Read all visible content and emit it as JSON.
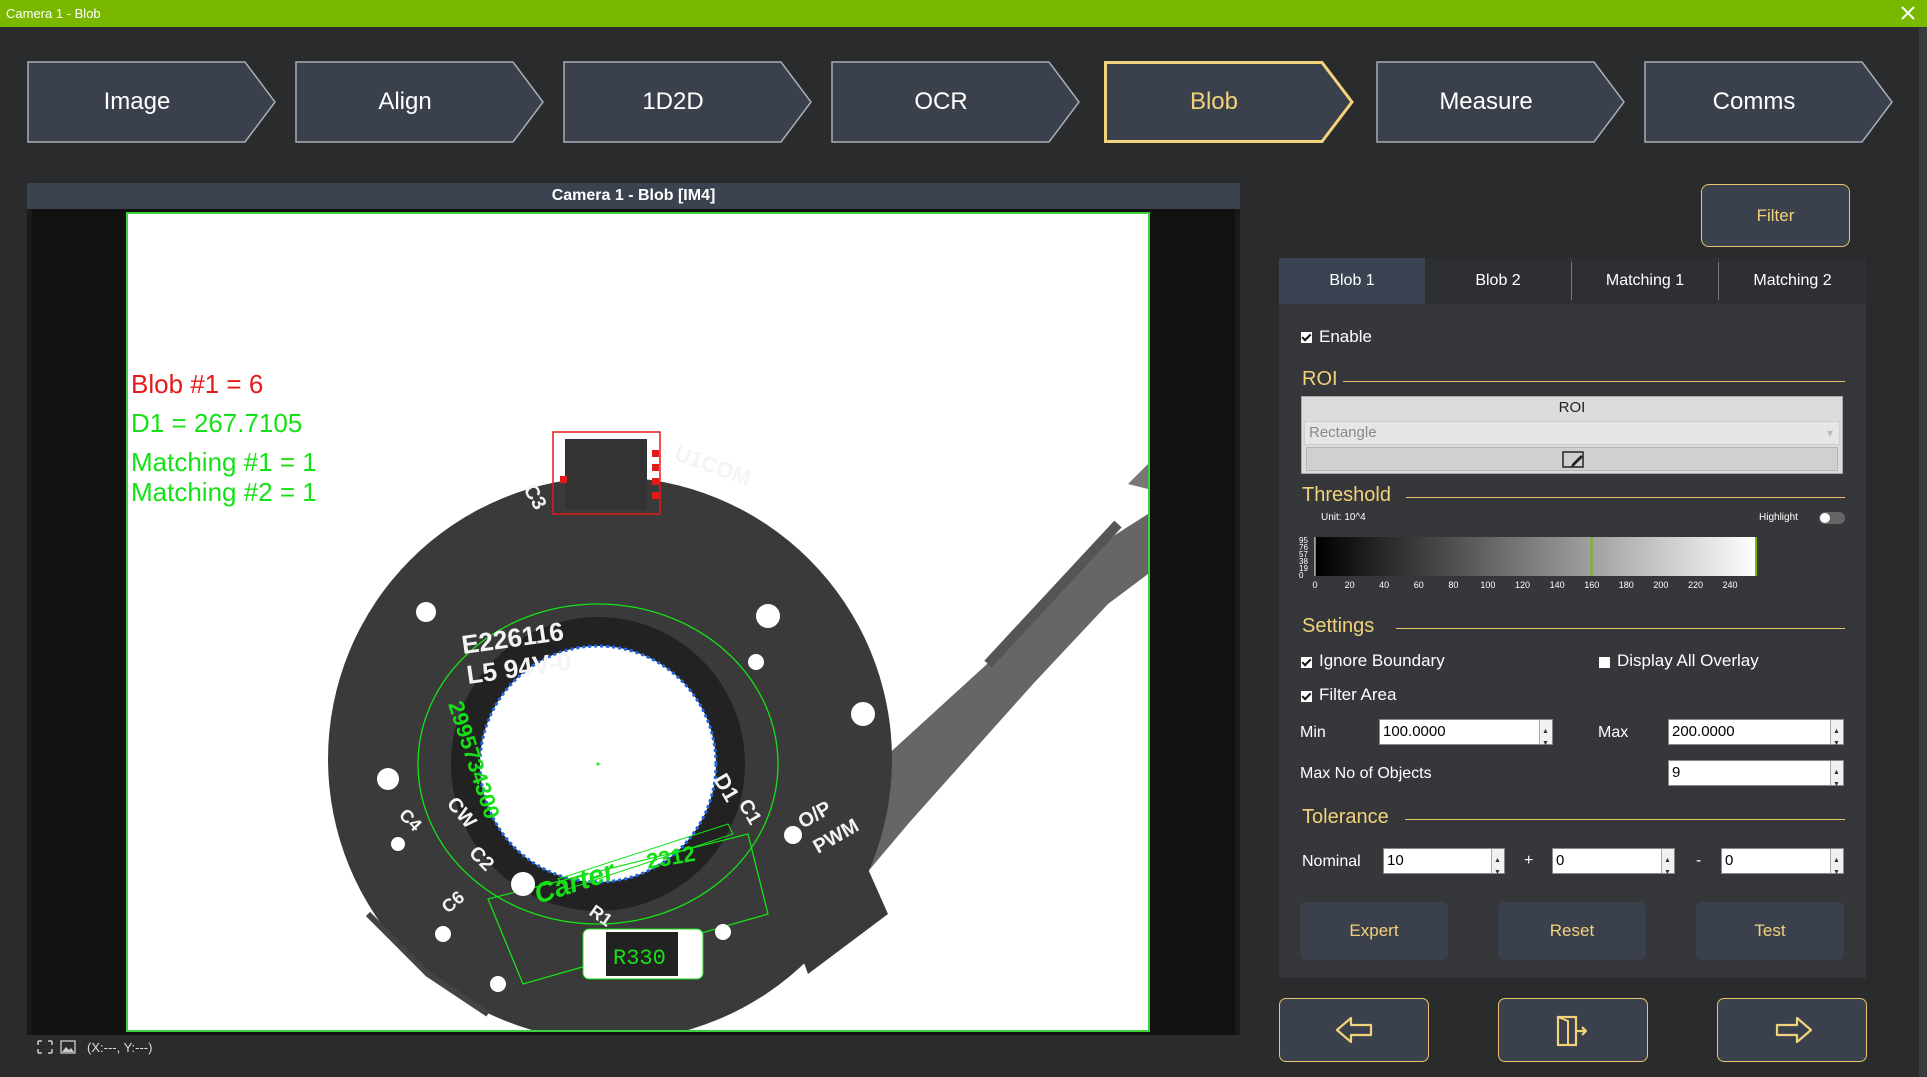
{
  "window": {
    "title": "Camera 1 - Blob"
  },
  "steps": [
    {
      "label": "Image",
      "active": false
    },
    {
      "label": "Align",
      "active": false
    },
    {
      "label": "1D2D",
      "active": false
    },
    {
      "label": "OCR",
      "active": false
    },
    {
      "label": "Blob",
      "active": true
    },
    {
      "label": "Measure",
      "active": false
    },
    {
      "label": "Comms",
      "active": false
    }
  ],
  "viewer": {
    "title": "Camera 1 - Blob  [IM4]",
    "coords": "(X:---, Y:---)",
    "overlays": {
      "blob": "Blob #1 = 6",
      "d1": "D1 = 267.7105",
      "matching1": "Matching #1 = 1",
      "matching2": "Matching #2 = 1"
    },
    "pcb_text": {
      "a": "E226116",
      "b": "L5 94V-0",
      "c": "U1COM",
      "d": "C3",
      "e": "2312",
      "f": "R330",
      "g": "Carter",
      "h": "2995734300",
      "i": "D1",
      "j": "C1",
      "k": "R1",
      "l": "C2",
      "m": "CW",
      "n": "C4",
      "o": "C6",
      "p": "O/P",
      "q": "PWM"
    }
  },
  "filter_button": "Filter",
  "tabs": [
    "Blob 1",
    "Blob 2",
    "Matching 1",
    "Matching 2"
  ],
  "enable": {
    "label": "Enable",
    "checked": true
  },
  "roi": {
    "section": "ROI",
    "box_title": "ROI",
    "shape": "Rectangle"
  },
  "threshold": {
    "section": "Threshold",
    "unit": "Unit: 10^4",
    "highlight_label": "Highlight",
    "y_ticks": [
      "95",
      "76",
      "57",
      "38",
      "19",
      "0"
    ],
    "x_ticks": [
      "0",
      "20",
      "40",
      "60",
      "80",
      "100",
      "120",
      "140",
      "160",
      "180",
      "200",
      "220",
      "240"
    ],
    "marker_value": 160
  },
  "settings": {
    "section": "Settings",
    "ignore_boundary": {
      "label": "Ignore Boundary",
      "checked": true
    },
    "display_all_overlay": {
      "label": "Display All Overlay",
      "checked": false
    },
    "filter_area": {
      "label": "Filter Area",
      "checked": true
    },
    "min_label": "Min",
    "min_value": "100.0000",
    "max_label": "Max",
    "max_value": "200.0000",
    "max_objects_label": "Max No of Objects",
    "max_objects_value": "9"
  },
  "tolerance": {
    "section": "Tolerance",
    "nominal_label": "Nominal",
    "nominal_value": "10",
    "plus_symbol": "+",
    "plus_value": "0",
    "minus_symbol": "-",
    "minus_value": "0"
  },
  "actions": {
    "expert": "Expert",
    "reset": "Reset",
    "test": "Test"
  },
  "colors": {
    "titlebar": "#7ab800",
    "accent": "#f2d27a",
    "overlay_red": "#e41a1a",
    "overlay_green": "#16e016"
  }
}
